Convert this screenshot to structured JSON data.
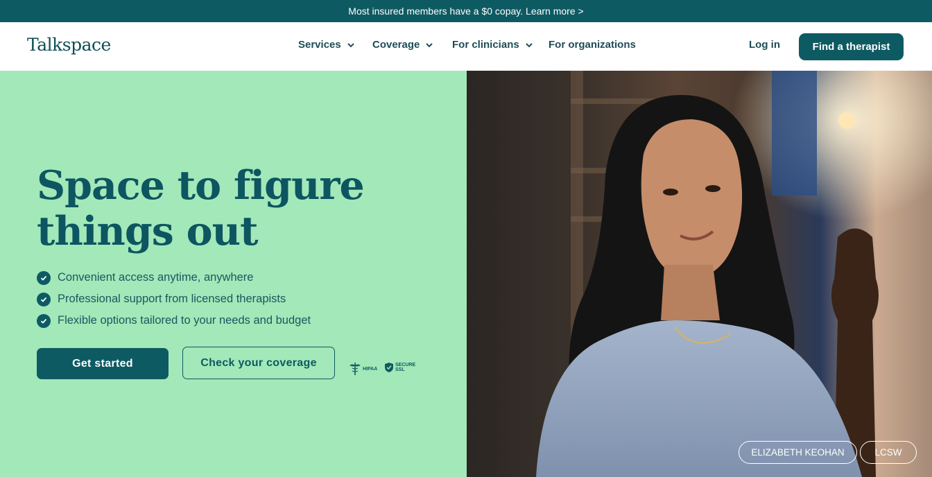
{
  "banner": {
    "text": "Most insured members have a $0 copay. Learn more >"
  },
  "nav": {
    "logo": "Talkspace",
    "items": [
      {
        "label": "Services",
        "has_dropdown": true
      },
      {
        "label": "Coverage",
        "has_dropdown": true
      },
      {
        "label": "For clinicians",
        "has_dropdown": true
      },
      {
        "label": "For organizations",
        "has_dropdown": false
      }
    ],
    "login": "Log in",
    "cta": "Find a therapist"
  },
  "hero": {
    "headline_line1": "Space to figure",
    "headline_line2": "things out",
    "benefits": [
      "Convenient access anytime, anywhere",
      "Professional support from licensed therapists",
      "Flexible options tailored to your needs and budget"
    ],
    "primary_button": "Get started",
    "secondary_button": "Check your coverage",
    "badges": {
      "hipaa": "HIPAA",
      "ssl_line1": "SECURE",
      "ssl_line2": "SSL"
    },
    "caption_name": "ELIZABETH KEOHAN",
    "caption_credential": "LCSW"
  },
  "colors": {
    "brand": "#0e5a63",
    "hero_background": "#a2e8b9"
  }
}
